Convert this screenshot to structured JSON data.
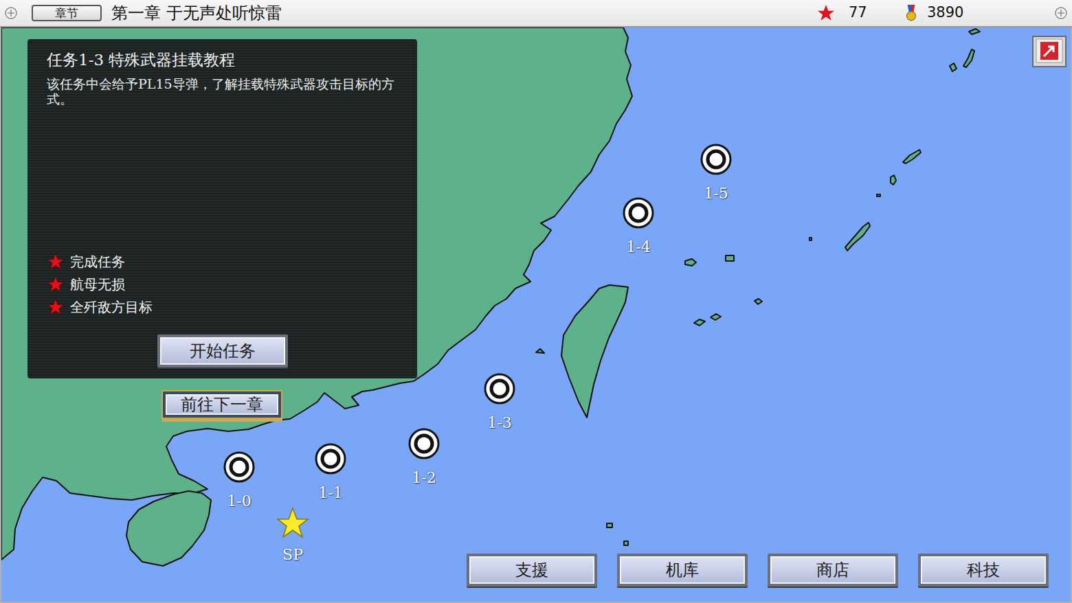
{
  "top_bar": {
    "chapter_button": "章节",
    "title": "第一章 于无声处听惊雷",
    "stars": "77",
    "medals": "3890"
  },
  "mission_panel": {
    "title": "任务1-3 特殊武器挂载教程",
    "description": "该任务中会给予PL15导弹，了解挂载特殊武器攻击目标的方式。",
    "objectives": [
      {
        "label": "完成任务",
        "achieved": true
      },
      {
        "label": "航母无损",
        "achieved": true
      },
      {
        "label": "全歼敌方目标",
        "achieved": true
      }
    ],
    "start_button": "开始任务"
  },
  "next_chapter_button": "前往下一章",
  "nodes": [
    {
      "label": "1-0",
      "kind": "mission"
    },
    {
      "label": "1-1",
      "kind": "mission"
    },
    {
      "label": "1-2",
      "kind": "mission"
    },
    {
      "label": "1-3",
      "kind": "mission"
    },
    {
      "label": "1-4",
      "kind": "mission"
    },
    {
      "label": "1-5",
      "kind": "mission"
    },
    {
      "label": "SP",
      "kind": "special"
    }
  ],
  "bottom_buttons": [
    "支援",
    "机库",
    "商店",
    "科技"
  ]
}
